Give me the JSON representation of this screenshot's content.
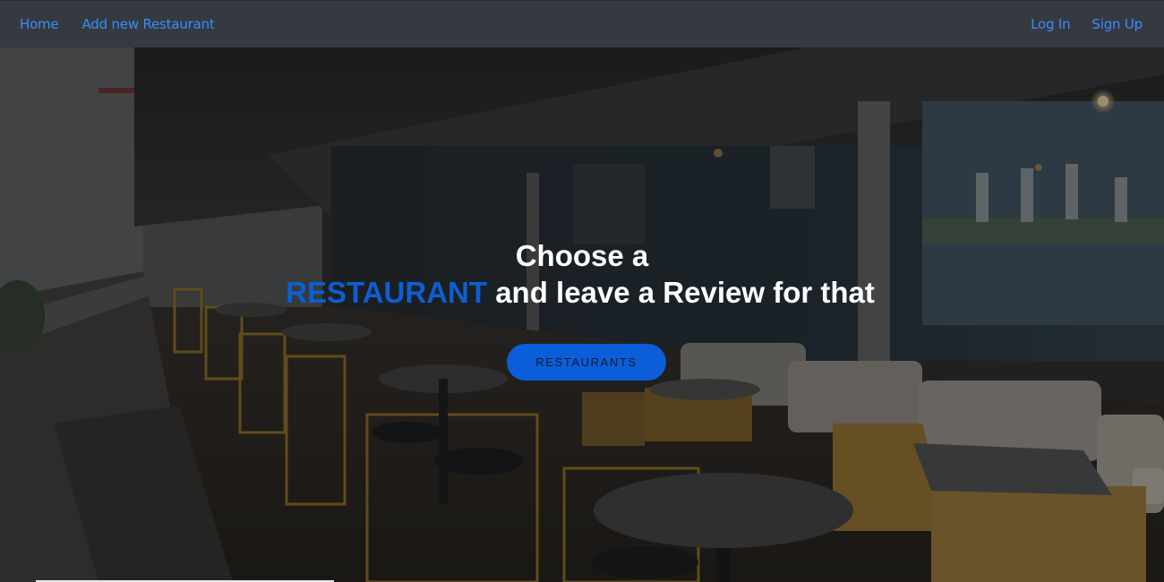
{
  "nav": {
    "left": [
      {
        "label": "Home"
      },
      {
        "label": "Add new Restaurant"
      }
    ],
    "right": [
      {
        "label": "Log In"
      },
      {
        "label": "Sign Up"
      }
    ]
  },
  "hero": {
    "line1": "Choose a",
    "accent_word": "RESTAURANT",
    "line2_rest": " and leave a Review for that",
    "button_label": "RESTAURANTS"
  },
  "colors": {
    "navbar_bg": "#343a40",
    "nav_link": "#3d8bfd",
    "accent": "#0d5fd0",
    "button_bg": "#0b5ed7"
  }
}
